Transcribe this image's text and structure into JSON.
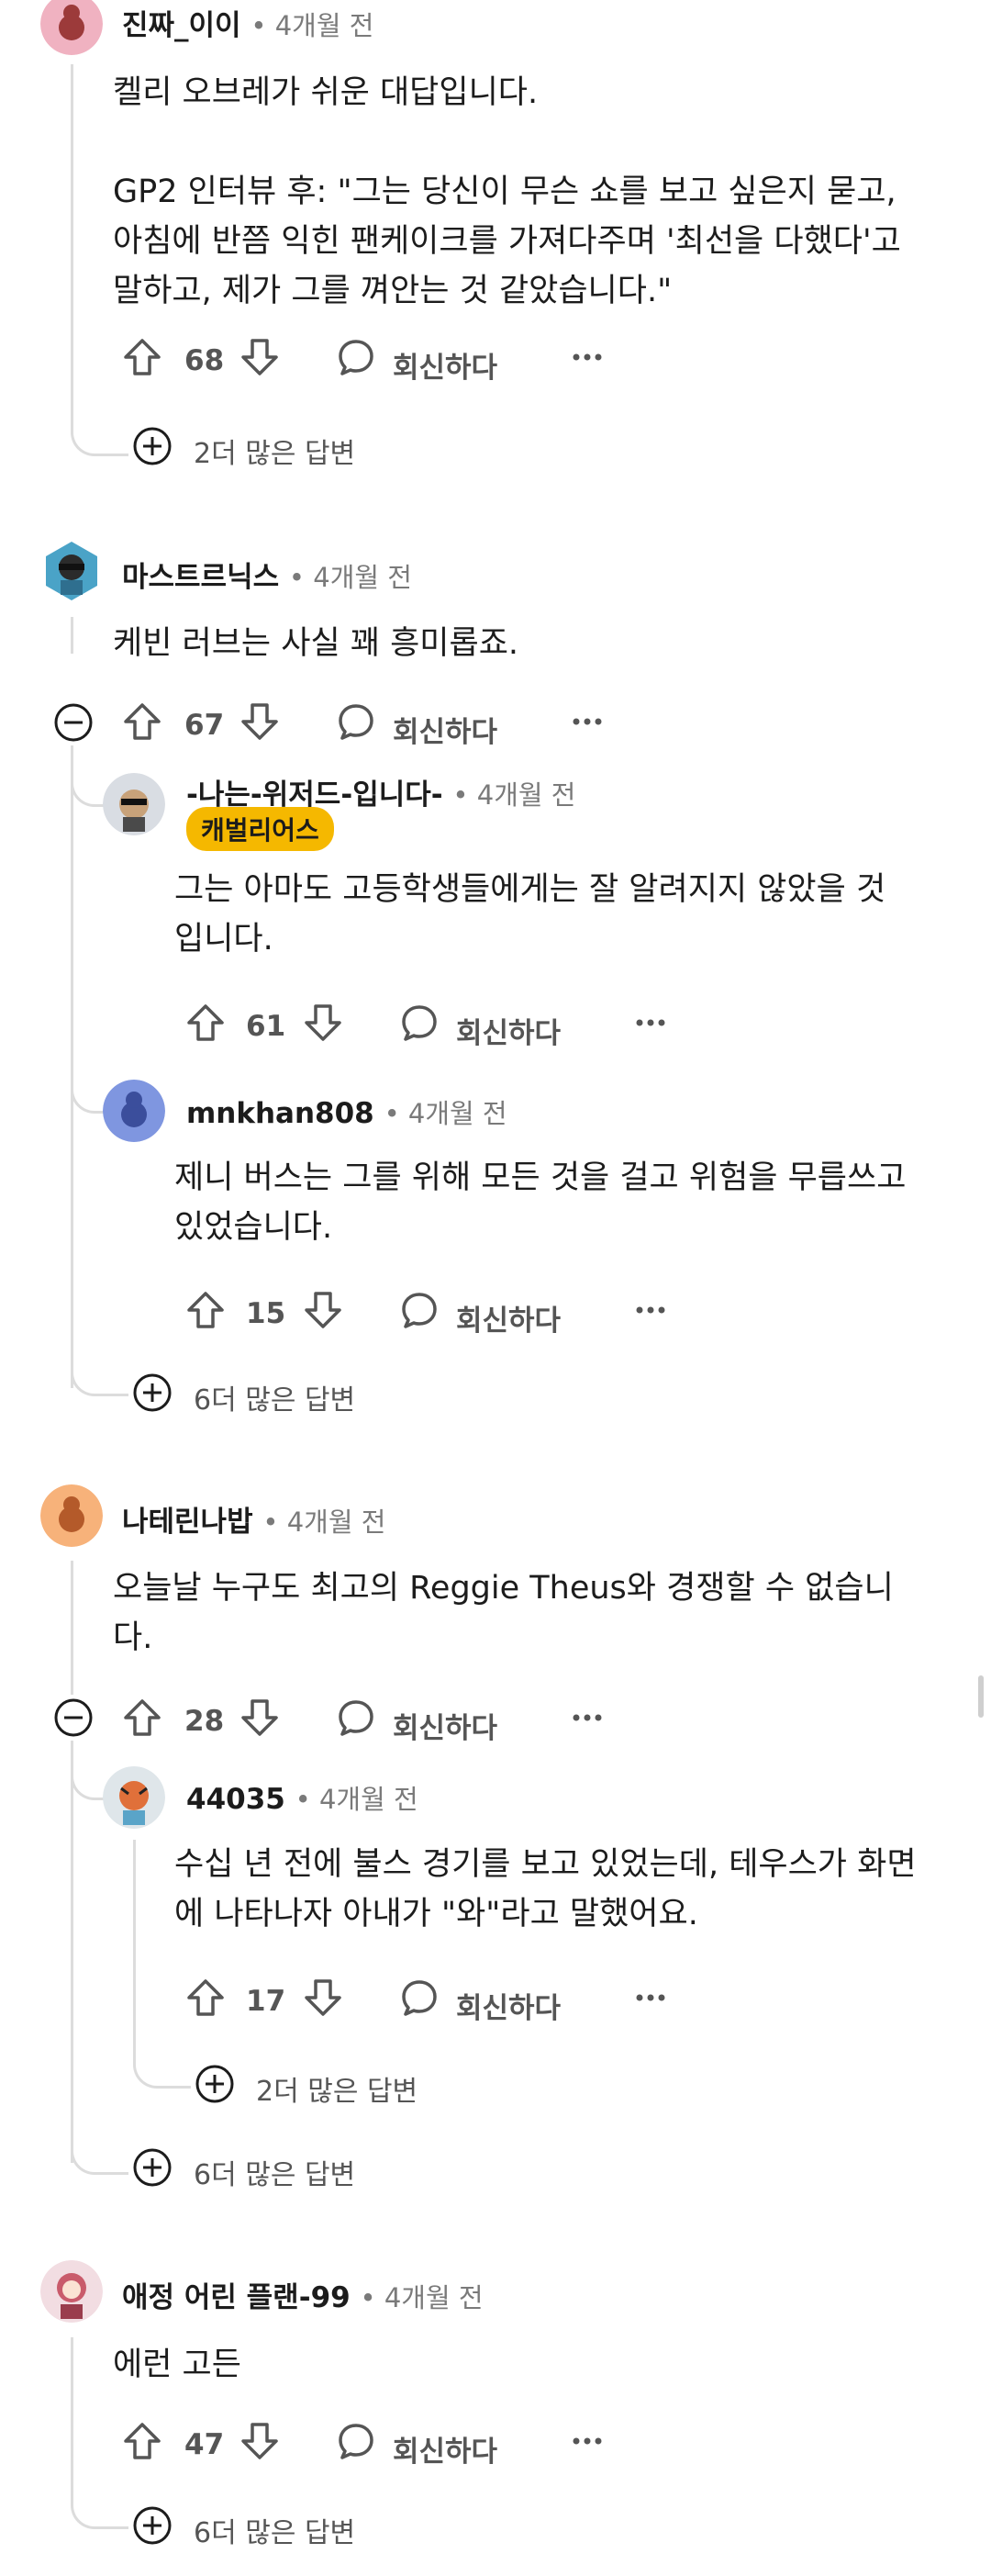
{
  "comments": [
    {
      "user": "진짜_이이",
      "time": "4개월 전",
      "text": [
        "켈리 오브레가 쉬운 대답입니다.",
        "",
        "GP2 인터뷰 후: \"그는 당신이 무슨 쇼를 보고 싶은지 묻고,",
        "아침에 반쯤 익힌 팬케이크를 가져다주며 '최선을 다했다'고",
        "말하고, 제가 그를 껴안는 것 같았습니다.\""
      ],
      "votes": "68",
      "reply": "회신하다",
      "more": "2더 많은 답변"
    },
    {
      "user": "마스트르닉스",
      "time": "4개월 전",
      "text": [
        "케빈 러브는 사실 꽤 흥미롭죠."
      ],
      "votes": "67",
      "reply": "회신하다",
      "more": "6더 많은 답변",
      "replies": [
        {
          "user": "-나는-위저드-입니다-",
          "time": "4개월 전",
          "flair": "캐벌리어스",
          "text": [
            "그는 아마도 고등학생들에게는 잘 알려지지 않았을 것",
            "입니다."
          ],
          "votes": "61",
          "reply": "회신하다"
        },
        {
          "user": "mnkhan808",
          "time": "4개월 전",
          "text": [
            "제니 버스는 그를 위해 모든 것을 걸고 위험을 무릅쓰고",
            "있었습니다."
          ],
          "votes": "15",
          "reply": "회신하다"
        }
      ]
    },
    {
      "user": "나테린나밥",
      "time": "4개월 전",
      "text": [
        "오늘날 누구도 최고의 Reggie Theus와 경쟁할 수 없습니",
        "다."
      ],
      "votes": "28",
      "reply": "회신하다",
      "more": "6더 많은 답변",
      "replies": [
        {
          "user": "44035",
          "time": "4개월 전",
          "text": [
            "수십 년 전에 불스 경기를 보고 있었는데, 테우스가 화면",
            "에 나타나자 아내가 \"와\"라고 말했어요."
          ],
          "votes": "17",
          "reply": "회신하다",
          "more": "2더 많은 답변"
        }
      ]
    },
    {
      "user": "애정 어린 플랜-99",
      "time": "4개월 전",
      "text": [
        "에런 고든"
      ],
      "votes": "47",
      "reply": "회신하다",
      "more": "6더 많은 답변"
    }
  ],
  "separator": "•",
  "colors": {
    "flair": "#f5b800",
    "thread_line": "#dcdcdc",
    "meta": "#7a7a7a"
  }
}
